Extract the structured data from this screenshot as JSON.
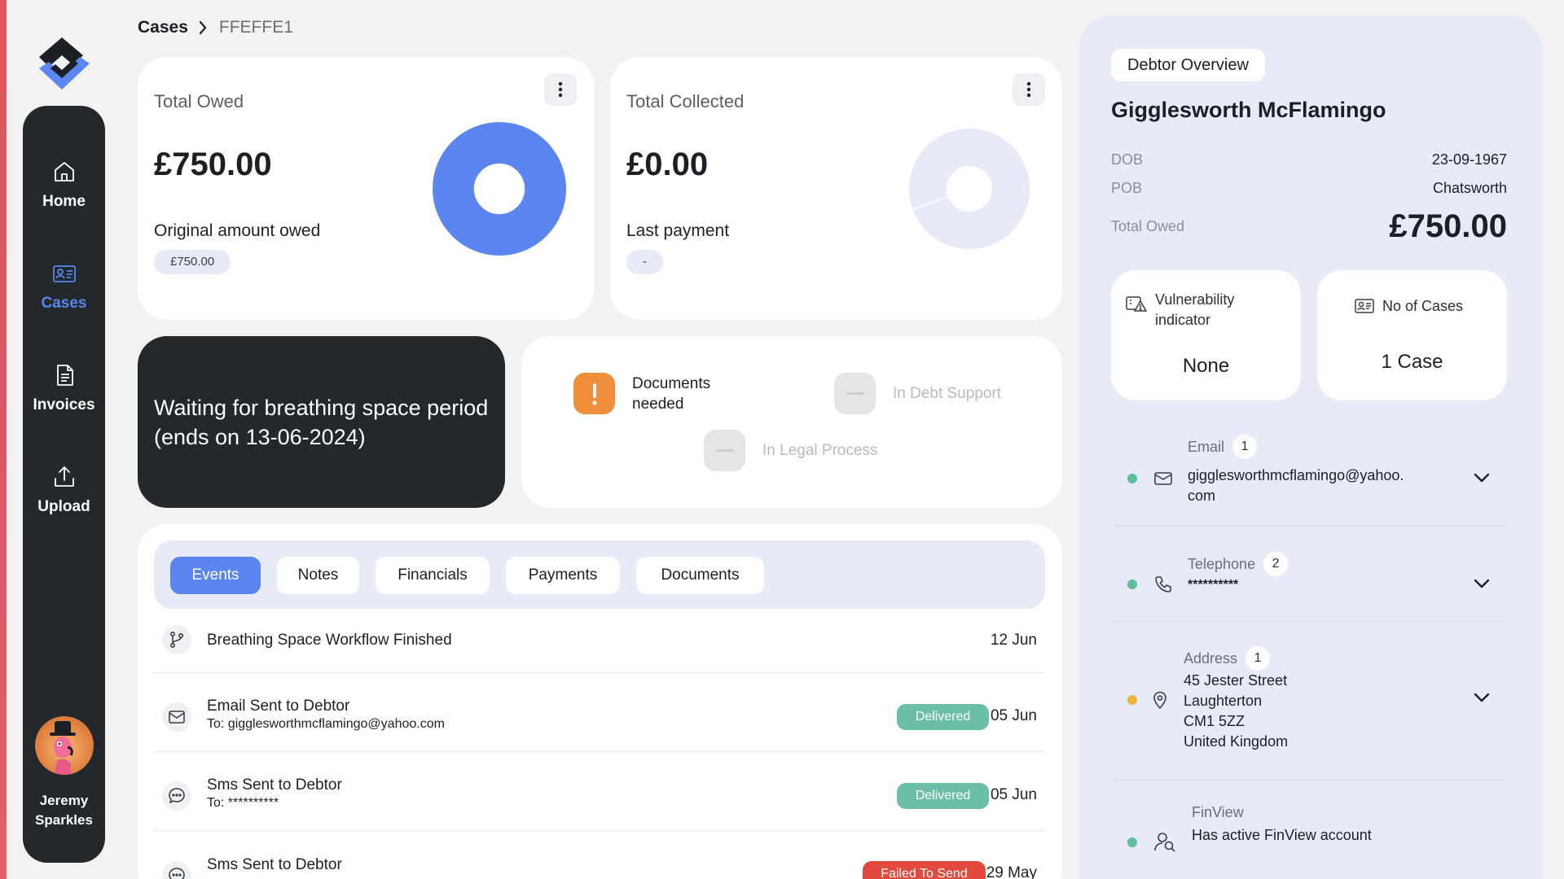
{
  "breadcrumb": {
    "root": "Cases",
    "current": "FFEFFE1"
  },
  "nav": {
    "items": [
      {
        "label": "Home",
        "icon": "home-icon"
      },
      {
        "label": "Cases",
        "icon": "id-card-icon"
      },
      {
        "label": "Invoices",
        "icon": "document-icon"
      },
      {
        "label": "Upload",
        "icon": "upload-icon"
      }
    ],
    "active": "Cases",
    "user": {
      "first": "Jeremy",
      "last": "Sparkles"
    }
  },
  "total_owed_card": {
    "title": "Total Owed",
    "amount": "£750.00",
    "sublabel": "Original amount owed",
    "pill": "£750.00",
    "donut_fraction": 1.0
  },
  "total_collected_card": {
    "title": "Total Collected",
    "amount": "£0.00",
    "sublabel": "Last payment",
    "pill": "-",
    "donut_fraction": 0.0
  },
  "status_banner": {
    "text": "Waiting for breathing space period (ends on 13-06-2024)"
  },
  "flags": [
    {
      "label_line1": "Documents",
      "label_line2": "needed",
      "state": "active",
      "icon": "exclamation-icon"
    },
    {
      "label_line1": "In Debt Support",
      "state": "inactive",
      "icon": "dash-icon"
    },
    {
      "label_line1": "In Legal Process",
      "state": "inactive",
      "icon": "dash-icon"
    }
  ],
  "tabs": [
    "Events",
    "Notes",
    "Financials",
    "Payments",
    "Documents"
  ],
  "active_tab": "Events",
  "events": [
    {
      "title": "Breathing Space Workflow Finished",
      "subtitle": "",
      "status": "",
      "date": "12 Jun",
      "icon": "branch-icon"
    },
    {
      "title": "Email Sent to Debtor",
      "subtitle": "To: gigglesworthmcflamingo@yahoo.com",
      "status": "Delivered",
      "date": "05 Jun",
      "icon": "mail-icon"
    },
    {
      "title": "Sms Sent to Debtor",
      "subtitle": "To: **********",
      "status": "Delivered",
      "date": "05 Jun",
      "icon": "chat-icon"
    },
    {
      "title": "Sms Sent to Debtor",
      "subtitle": "",
      "status": "Failed To Send",
      "date": "29 May",
      "icon": "chat-icon"
    }
  ],
  "colors": {
    "accent": "#5b86f0",
    "delivered": "#6bbfa6",
    "failed": "#e34a3e",
    "warning": "#ef8f3c",
    "dark": "#23282c"
  },
  "debtor": {
    "tag": "Debtor Overview",
    "name": "Gigglesworth McFlamingo",
    "dob_label": "DOB",
    "dob": "23-09-1967",
    "pob_label": "POB",
    "pob": "Chatsworth",
    "owed_label": "Total Owed",
    "owed": "£750.00",
    "vulnerability_label_1": "Vulnerability",
    "vulnerability_label_2": "indicator",
    "vulnerability": "None",
    "cases_label": "No of Cases",
    "cases": "1 Case",
    "email": {
      "label": "Email",
      "count": "1",
      "line1": "gigglesworthmcflamingo@yahoo.",
      "line2": "com",
      "status": "green"
    },
    "telephone": {
      "label": "Telephone",
      "count": "2",
      "value": "**********",
      "status": "green"
    },
    "address": {
      "label": "Address",
      "count": "1",
      "line1": "45 Jester Street",
      "line2": "Laughterton",
      "line3": "CM1 5ZZ",
      "line4": "United Kingdom",
      "status": "amber"
    },
    "finview": {
      "label": "FinView",
      "value": "Has active FinView account",
      "status": "green"
    }
  }
}
